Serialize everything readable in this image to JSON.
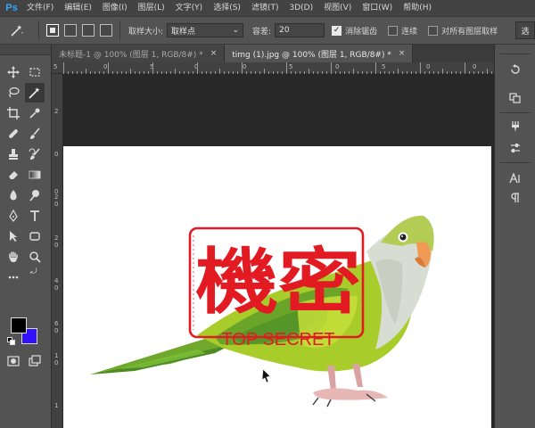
{
  "app": {
    "logo": "Ps"
  },
  "menu": [
    "文件(F)",
    "编辑(E)",
    "图像(I)",
    "图层(L)",
    "文字(Y)",
    "选择(S)",
    "滤镜(T)",
    "3D(D)",
    "视图(V)",
    "窗口(W)",
    "帮助(H)"
  ],
  "options": {
    "sample_size_label": "取样大小:",
    "sample_size_value": "取样点",
    "tolerance_label": "容差:",
    "tolerance_value": "20",
    "antialias_label": "消除锯齿",
    "contiguous_label": "连续",
    "all_layers_label": "对所有图层取样",
    "right_button": "选"
  },
  "tabs": [
    {
      "label": "未标题-1 @ 100% (图层 1, RGB/8#) *",
      "close": "×"
    },
    {
      "label": "timg (1).jpg @ 100% (图层 1, RGB/8#) *",
      "close": "×"
    }
  ],
  "ruler_top": [
    "5",
    "0",
    "5",
    "0",
    "0",
    "5",
    "0",
    "5",
    "0",
    "0"
  ],
  "ruler_left": [
    "2",
    "0",
    "0",
    "2",
    "0",
    "2",
    "0",
    "4",
    "0",
    "6",
    "0",
    "1",
    "0",
    "1"
  ],
  "stamp": {
    "text": "機密",
    "subtitle": "TOP SECRET",
    "color": "#e21b23"
  },
  "colors": {
    "foreground": "#000000",
    "background": "#3311ff",
    "accent": "#31a8ff"
  }
}
